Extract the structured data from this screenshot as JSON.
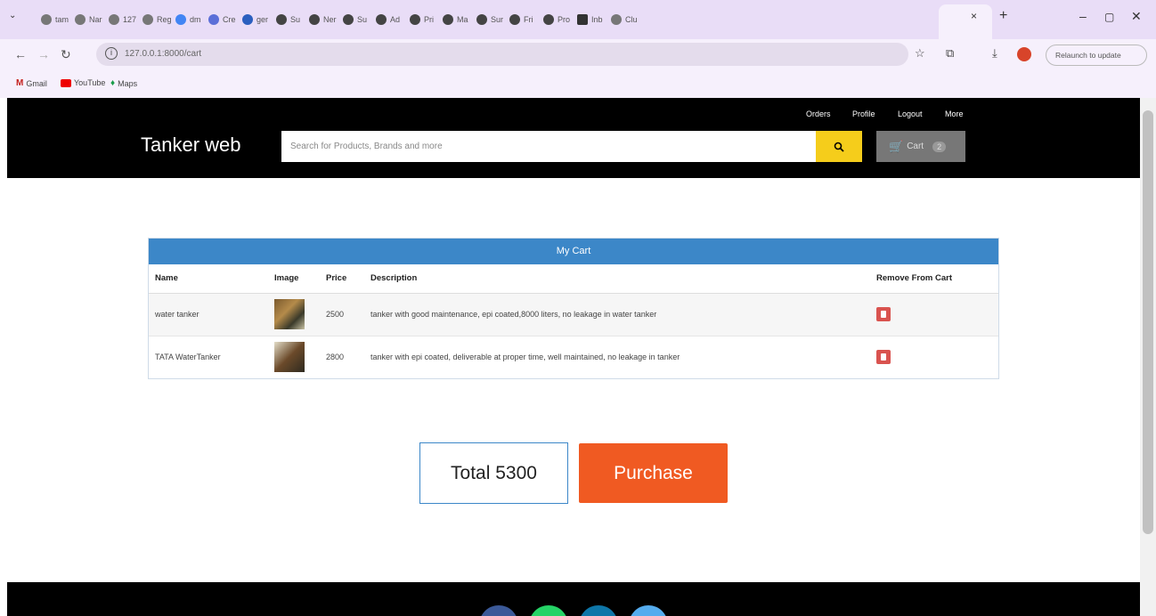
{
  "browser": {
    "tabs": [
      "tam",
      "Nar",
      "127",
      "Reg",
      "dm",
      "Cre",
      "ger",
      "Su",
      "Ner",
      "Su",
      "Ad",
      "Pri",
      "Ma",
      "Sur",
      "Fri",
      "Pro",
      "Inb",
      "Clu"
    ],
    "new_tab": "+",
    "url": "127.0.0.1:8000/cart",
    "relaunch_label": "Relaunch to update",
    "bookmarks": [
      "Gmail",
      "YouTube",
      "Maps"
    ]
  },
  "header": {
    "brand": "Tanker web",
    "links": [
      "Orders",
      "Profile",
      "Logout",
      "More"
    ],
    "search_placeholder": "Search for Products, Brands and more",
    "cart_label": "Cart",
    "cart_count": "2"
  },
  "cart": {
    "title": "My Cart",
    "columns": [
      "Name",
      "Image",
      "Price",
      "Description",
      "Remove From Cart"
    ],
    "rows": [
      {
        "name": "water tanker",
        "price": "2500",
        "description": "tanker with good maintenance, epi coated,8000 liters, no leakage in water tanker"
      },
      {
        "name": "TATA WaterTanker",
        "price": "2800",
        "description": "tanker with epi coated, deliverable at proper time, well maintained, no leakage in tanker"
      }
    ]
  },
  "summary": {
    "total_label": "Total 5300",
    "purchase_label": "Purchase"
  },
  "colors": {
    "header_bg": "#000000",
    "cart_head": "#3c87c8",
    "purchase": "#f05a22",
    "search_btn": "#f5cd1b",
    "remove": "#d9534f"
  }
}
